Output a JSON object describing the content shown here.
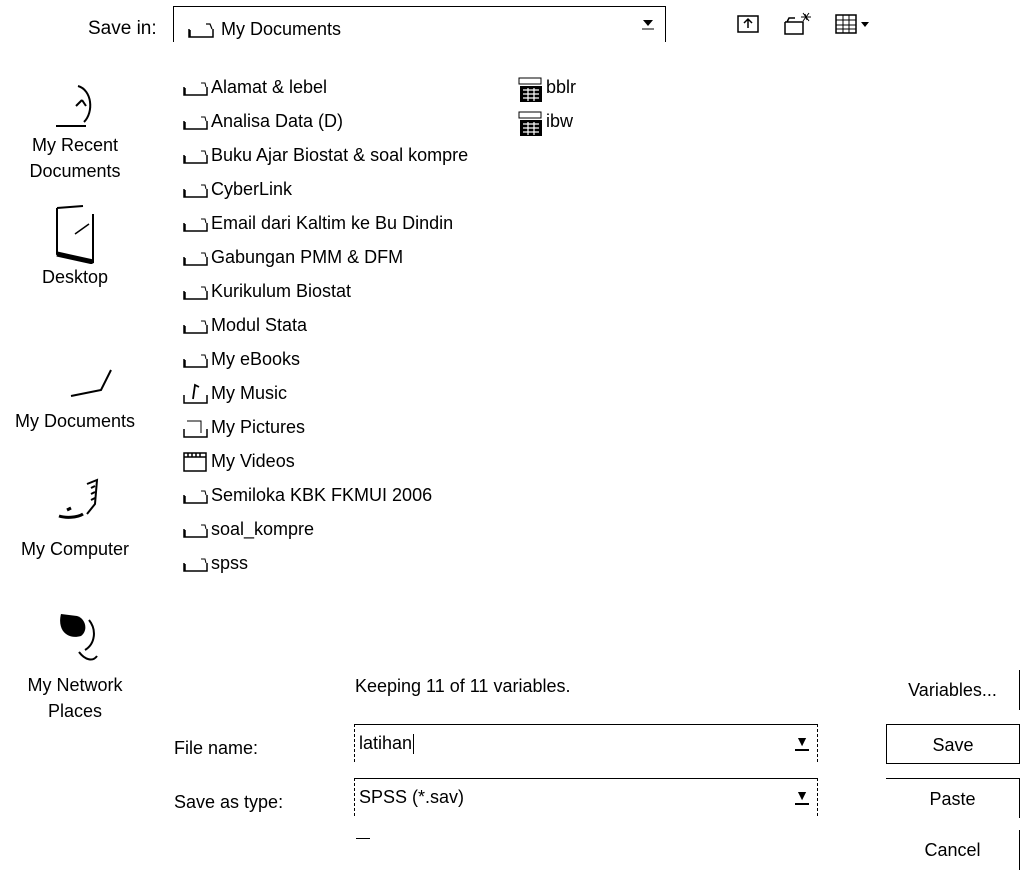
{
  "save_in": {
    "label": "Save in:",
    "value": "My Documents"
  },
  "toolbar": {
    "icons": [
      "up-one-level-icon",
      "create-new-folder-icon",
      "view-menu-icon"
    ]
  },
  "places": [
    {
      "label": "My Recent Documents",
      "icon": "recent-documents-icon"
    },
    {
      "label": "Desktop",
      "icon": "desktop-icon"
    },
    {
      "label": "My Documents",
      "icon": "my-documents-icon"
    },
    {
      "label": "My Computer",
      "icon": "my-computer-icon"
    },
    {
      "label": "My Network Places",
      "icon": "network-places-icon"
    }
  ],
  "folders": [
    {
      "name": "Alamat & lebel",
      "icon": "folder-icon"
    },
    {
      "name": "Analisa Data (D)",
      "icon": "folder-icon"
    },
    {
      "name": "Buku Ajar Biostat & soal kompre",
      "icon": "folder-icon"
    },
    {
      "name": "CyberLink",
      "icon": "folder-icon"
    },
    {
      "name": "Email dari Kaltim ke Bu Dindin",
      "icon": "folder-icon"
    },
    {
      "name": "Gabungan PMM & DFM",
      "icon": "folder-icon"
    },
    {
      "name": "Kurikulum Biostat",
      "icon": "folder-icon"
    },
    {
      "name": "Modul Stata",
      "icon": "folder-icon"
    },
    {
      "name": "My eBooks",
      "icon": "folder-icon"
    },
    {
      "name": "My Music",
      "icon": "music-folder-icon"
    },
    {
      "name": "My Pictures",
      "icon": "pictures-folder-icon"
    },
    {
      "name": "My Videos",
      "icon": "videos-folder-icon"
    },
    {
      "name": "Semiloka KBK FKMUI 2006",
      "icon": "folder-icon"
    },
    {
      "name": "soal_kompre",
      "icon": "folder-icon"
    },
    {
      "name": "spss",
      "icon": "folder-icon"
    }
  ],
  "files": [
    {
      "name": "bblr",
      "icon": "spss-data-file-icon"
    },
    {
      "name": "ibw",
      "icon": "spss-data-file-icon"
    }
  ],
  "status": "Keeping 11 of 11 variables.",
  "file_name": {
    "label": "File name:",
    "value": "latihan"
  },
  "save_as_type": {
    "label": "Save as type:",
    "value": "SPSS (*.sav)"
  },
  "buttons": {
    "variables": "Variables...",
    "save": "Save",
    "paste": "Paste",
    "cancel": "Cancel"
  }
}
